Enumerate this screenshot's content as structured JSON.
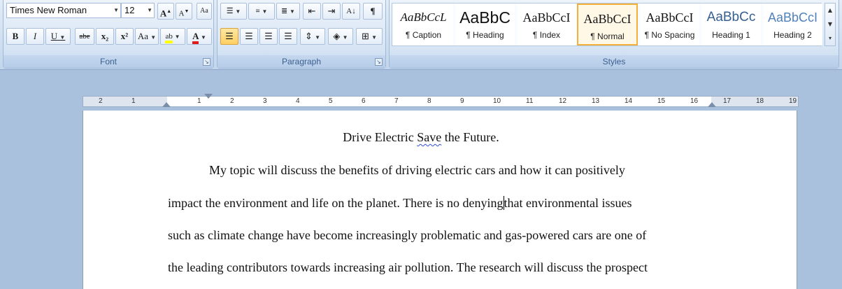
{
  "font_group": {
    "label": "Font",
    "font_name": "Times New Roman",
    "font_size": "12",
    "grow_font": "A",
    "shrink_font": "A",
    "clear_formatting": "Aa",
    "bold": "B",
    "italic": "I",
    "underline": "U",
    "strikethrough": "abe",
    "subscript": "x₂",
    "superscript": "x²",
    "change_case": "Aa",
    "highlight": "ab",
    "font_color": "A",
    "highlight_color": "#ffff00",
    "font_color_value": "#e01b1b"
  },
  "paragraph_group": {
    "label": "Paragraph",
    "show_marks": "¶"
  },
  "styles_group": {
    "label": "Styles",
    "items": [
      {
        "sample": "AaBbCcL",
        "name": "¶ Caption"
      },
      {
        "sample": "AaBbC",
        "name": "¶ Heading"
      },
      {
        "sample": "AaBbCcI",
        "name": "¶ Index"
      },
      {
        "sample": "AaBbCcI",
        "name": "¶ Normal"
      },
      {
        "sample": "AaBbCcI",
        "name": "¶ No Spacing"
      },
      {
        "sample": "AaBbCc",
        "name": "Heading 1"
      },
      {
        "sample": "AaBbCcI",
        "name": "Heading 2"
      }
    ],
    "selected": "¶ Normal",
    "heading_color": "#4f81bd"
  },
  "ruler": {
    "left_ticks": [
      "2",
      "1"
    ],
    "right_ticks": [
      "1",
      "2",
      "3",
      "4",
      "5",
      "6",
      "7",
      "8",
      "9",
      "10",
      "11",
      "12",
      "13",
      "14",
      "15",
      "16",
      "17",
      "18",
      "19"
    ]
  },
  "document": {
    "title_part1": "Drive Electric ",
    "title_misspelled": "Save",
    "title_part2": " the Future.",
    "lines": [
      "My topic will discuss the benefits of driving electric cars and how it can positively",
      "impact the environment and life on the planet. There is no denying",
      "that environmental issues",
      "such as climate change have become  increasingly problematic and gas-powered cars are one of",
      "the leading contributors towards increasing air pollution. The research will discuss the prospect"
    ]
  }
}
